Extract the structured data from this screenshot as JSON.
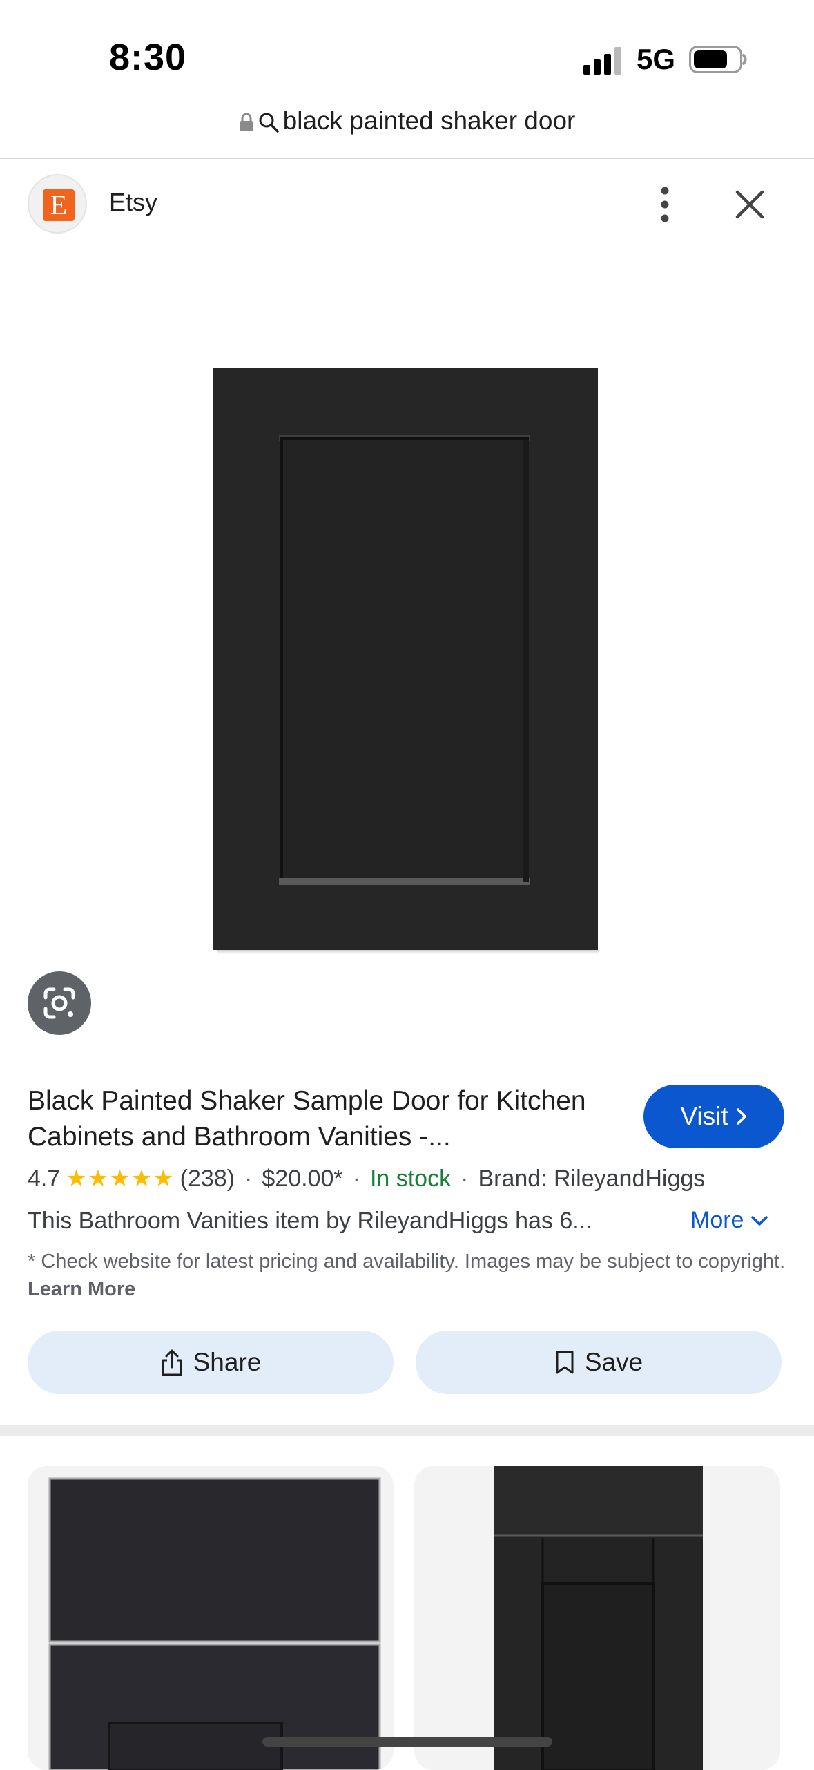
{
  "status_bar": {
    "time": "8:30",
    "network": "5G",
    "battery_level": 0.75
  },
  "address_bar": {
    "query": "black painted shaker door"
  },
  "source": {
    "logo_letter": "E",
    "logo_color": "#f1641e",
    "name": "Etsy"
  },
  "product": {
    "title": "Black Painted Shaker Sample Door for Kitchen Cabinets and Bathroom Vanities -...",
    "visit_label": "Visit",
    "rating": "4.7",
    "stars": "★★★★★",
    "rating_value": 4.7,
    "review_count": "(238)",
    "price": "$20.00*",
    "stock": "In stock",
    "brand": "Brand: RileyandHiggs",
    "description": "This Bathroom Vanities item by RileyandHiggs has 6...",
    "more_label": "More",
    "disclaimer": "* Check website for latest pricing and availability. Images may be subject to copyright.",
    "learn_more": "Learn More"
  },
  "actions": {
    "share_label": "Share",
    "save_label": "Save"
  },
  "colors": {
    "accent": "#0b57d0",
    "pill_bg": "#e3edf9",
    "in_stock": "#188038",
    "star": "#fbbc04"
  },
  "icons": {
    "lock": "lock-icon",
    "search": "search-icon",
    "more": "more-vert-icon",
    "close": "close-icon",
    "lens": "lens-icon",
    "share": "share-icon",
    "save": "bookmark-icon"
  }
}
